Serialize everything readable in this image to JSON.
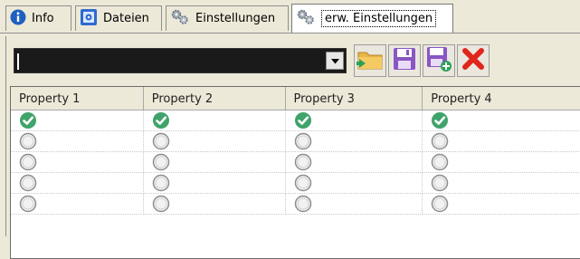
{
  "tabs": [
    {
      "label": "Info",
      "icon": "info-icon"
    },
    {
      "label": "Dateien",
      "icon": "disk-icon"
    },
    {
      "label": "Einstellungen",
      "icon": "gears-icon"
    },
    {
      "label": "erw. Einstellungen",
      "icon": "gears-icon",
      "active": true
    }
  ],
  "toolbar": {
    "combo_value": "",
    "buttons": [
      "open-folder-icon",
      "save-icon",
      "save-new-icon",
      "delete-icon"
    ]
  },
  "grid": {
    "columns": [
      "Property 1",
      "Property 2",
      "Property 3",
      "Property 4"
    ],
    "rows": [
      [
        "checked",
        "checked",
        "checked",
        "checked"
      ],
      [
        "unchecked",
        "unchecked",
        "unchecked",
        "unchecked"
      ],
      [
        "unchecked",
        "unchecked",
        "unchecked",
        "unchecked"
      ],
      [
        "unchecked",
        "unchecked",
        "unchecked",
        "unchecked"
      ],
      [
        "unchecked",
        "unchecked",
        "unchecked",
        "unchecked"
      ]
    ]
  },
  "colors": {
    "check": "#3fa36a",
    "delete": "#e0261b",
    "save": "#7b4bb3"
  }
}
